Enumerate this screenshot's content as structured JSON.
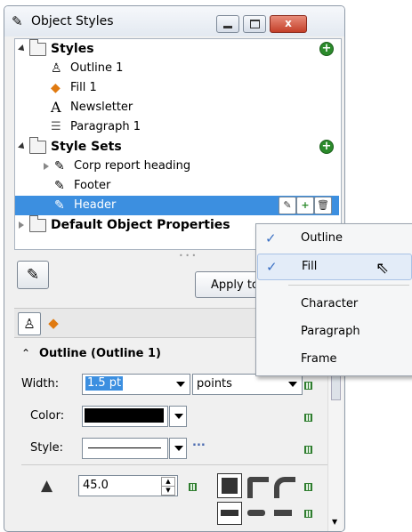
{
  "window": {
    "title": "Object Styles",
    "close_glyph": "x"
  },
  "tree": {
    "styles_label": "Styles",
    "outline_label": "Outline 1",
    "fill_label": "Fill 1",
    "newsletter_label": "Newsletter",
    "paragraph_label": "Paragraph 1",
    "style_sets_label": "Style Sets",
    "corp_label": "Corp report heading",
    "footer_label": "Footer",
    "header_label": "Header",
    "default_props_label": "Default Object Properties"
  },
  "apply_button": "Apply to",
  "properties": {
    "section_title": "Outline (Outline 1)",
    "width_label": "Width:",
    "width_value": "1.5 pt",
    "units_value": "points",
    "color_label": "Color:",
    "color_value": "#000000",
    "style_label": "Style:",
    "more_label": "...",
    "miter_value": "45.0"
  },
  "context_menu": {
    "items": [
      {
        "label": "Outline",
        "checked": true
      },
      {
        "label": "Fill",
        "checked": true
      },
      {
        "label": "Character",
        "checked": false
      },
      {
        "label": "Paragraph",
        "checked": false
      },
      {
        "label": "Frame",
        "checked": false
      }
    ]
  },
  "colors": {
    "selection": "#3c8fe0",
    "add_green": "#2b8a2b"
  }
}
